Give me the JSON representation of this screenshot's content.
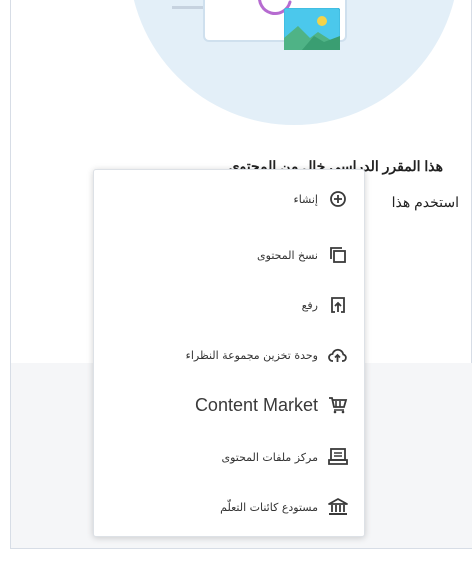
{
  "empty_state": {
    "title": "هذا المقرر الدراسي خالٍ من المحتوى",
    "description": "استخدم هذا"
  },
  "menu": {
    "items": [
      {
        "label": "إنشاء",
        "icon": "plus-circle-icon"
      },
      {
        "label": "نسخ المحتوى",
        "icon": "copy-icon"
      },
      {
        "label": "رفع",
        "icon": "upload-icon"
      },
      {
        "label": "وحدة تخزين مجموعة النظراء",
        "icon": "cloud-upload-icon"
      },
      {
        "label": "Content Market",
        "icon": "cart-icon"
      },
      {
        "label": "مركز ملفات المحتوى",
        "icon": "archive-tray-icon"
      },
      {
        "label": "مستودع كائنات التعلّم",
        "icon": "institution-icon"
      }
    ]
  },
  "colors": {
    "hero_circle": "#e3eff8",
    "icon": "#3a3a3a",
    "menu_border": "#dde1e6",
    "band": "#f5f6f8"
  }
}
